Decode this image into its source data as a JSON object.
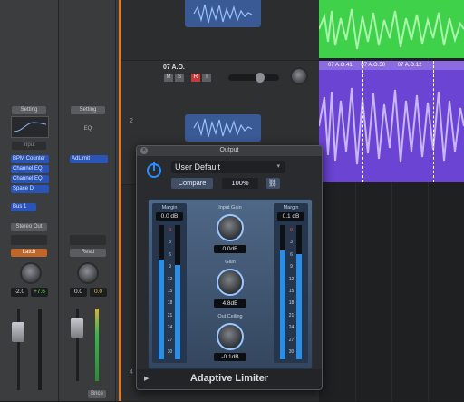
{
  "strip1": {
    "setting": "Setting",
    "eq": "",
    "input": "Input",
    "plugins": [
      "BPM Counter",
      "Channel EQ",
      "Channel EQ",
      "Space D"
    ],
    "send": "Bus 1",
    "output": "Stereo Out",
    "automation": "Latch",
    "pan_value": "-2.0",
    "level_value": "+7.6"
  },
  "strip2": {
    "setting": "Setting",
    "eq": "EQ",
    "plugins": [
      "AdLimit"
    ],
    "automation": "Read",
    "pan_value": "0.0",
    "level_value": "0.0",
    "bottom_label": "Bnce"
  },
  "track": {
    "name": "07 A.O.",
    "buttons": [
      "M",
      "S",
      "R",
      "I"
    ],
    "number": "2",
    "number2": "4",
    "regions": [
      "07 A.O.41",
      "07 A.O.50",
      "07 A.O.12"
    ]
  },
  "plugin": {
    "window_title": "Output",
    "preset": "User Default",
    "compare_label": "Compare",
    "zoom": "100%",
    "input_gain_label": "Input Gain",
    "input_gain_value": "0.0dB",
    "gain_label": "Gain",
    "gain_value": "4.8dB",
    "outceiling_label": "Out Ceiling",
    "outceiling_value": "-0.1dB",
    "left_margin_label": "Margin",
    "left_margin_value": "0.0 dB",
    "right_margin_label": "Margin",
    "right_margin_value": "0.1 dB",
    "scale": [
      "0",
      "3",
      "6",
      "9",
      "12",
      "15",
      "18",
      "21",
      "24",
      "27",
      "30"
    ],
    "footer_title": "Adaptive Limiter"
  },
  "colors": {
    "region_green": "#3fd14a",
    "region_purple": "#6b44d4",
    "accent_orange": "#e07a2b",
    "power_blue": "#2a8fff"
  }
}
